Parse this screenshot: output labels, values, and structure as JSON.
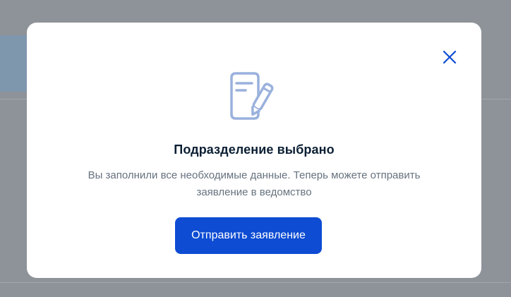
{
  "modal": {
    "title": "Подразделение выбрано",
    "description": "Вы заполнили все необходимые данные. Теперь можете отправить заявление в ведомство",
    "submit_label": "Отправить заявление",
    "close_icon": "close-icon",
    "illustration_icon": "document-pencil-icon"
  },
  "colors": {
    "primary": "#0d4cd3",
    "title": "#0b1f33",
    "text": "#66727f",
    "icon": "#9ab1dd",
    "close": "#0d4cd3"
  }
}
